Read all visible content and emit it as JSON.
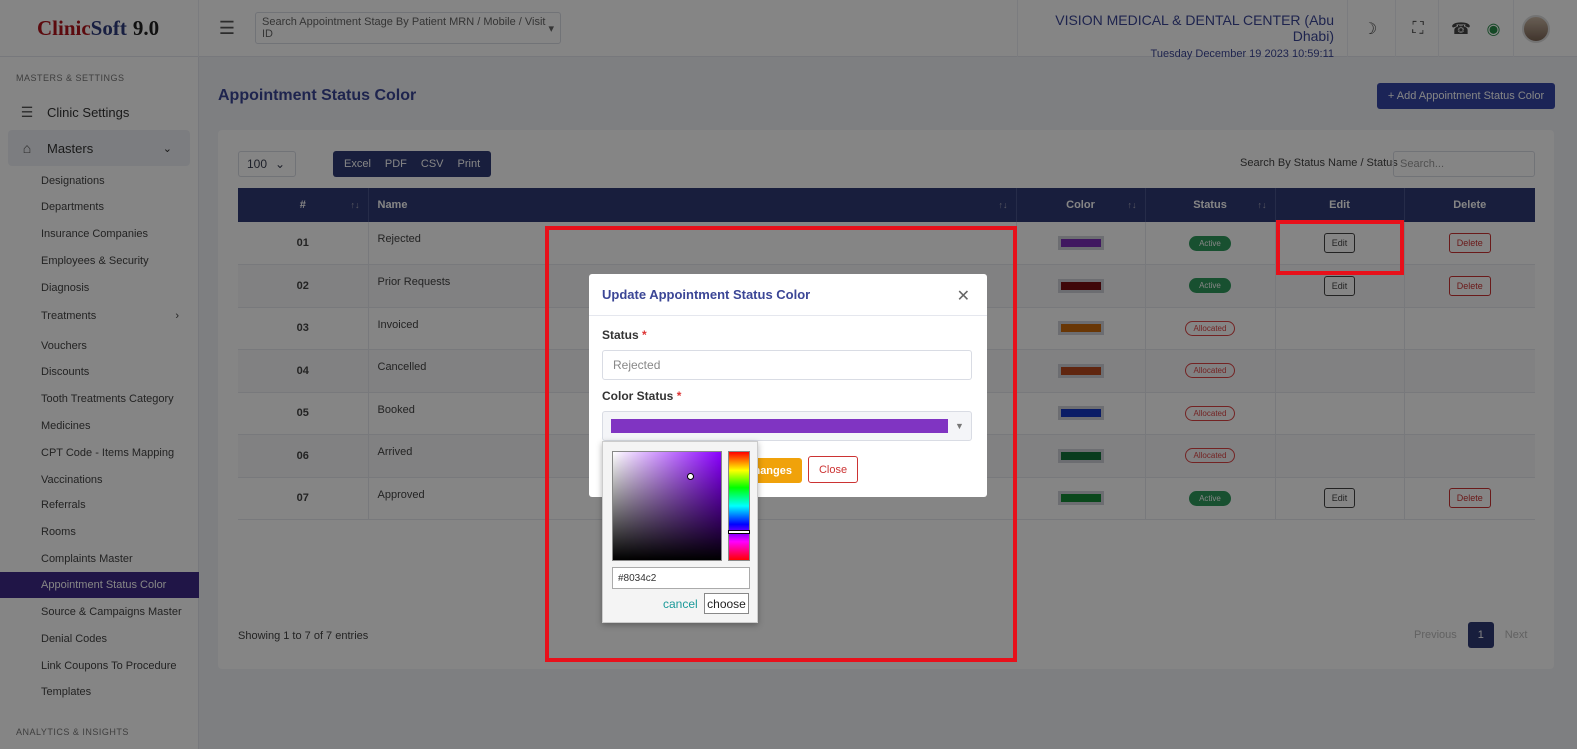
{
  "brand": {
    "part1": "Clinic",
    "part2": "Soft",
    "version": "9.0"
  },
  "header": {
    "search_placeholder": "Search Appointment Stage By Patient MRN / Mobile / Visit ID",
    "clinic_name": "VISION MEDICAL & DENTAL CENTER (Abu Dhabi)",
    "datetime": "Tuesday December 19 2023 10:59:11"
  },
  "sidebar": {
    "section1": "MASTERS & SETTINGS",
    "clinic_settings": "Clinic Settings",
    "masters": "Masters",
    "items": [
      "Designations",
      "Departments",
      "Insurance Companies",
      "Employees & Security",
      "Diagnosis",
      "Treatments",
      "Vouchers",
      "Discounts",
      "Tooth Treatments Category",
      "Medicines",
      "CPT Code - Items Mapping",
      "Vaccinations",
      "Referrals",
      "Rooms",
      "Complaints Master",
      "Appointment Status Color",
      "Source & Campaigns Master",
      "Denial Codes",
      "Link Coupons To Procedure",
      "Templates"
    ],
    "section2": "ANALYTICS & INSIGHTS"
  },
  "page": {
    "title": "Appointment Status Color",
    "add_button": "+ Add Appointment Status Color",
    "page_length": "100",
    "export": {
      "excel": "Excel",
      "pdf": "PDF",
      "csv": "CSV",
      "print": "Print"
    },
    "search_label": "Search By Status Name / Status",
    "search_placeholder": "Search...",
    "showing": "Showing 1 to 7 of 7 entries",
    "pager": {
      "previous": "Previous",
      "current": "1",
      "next": "Next"
    }
  },
  "table": {
    "headers": {
      "num": "#",
      "name": "Name",
      "color": "Color",
      "status": "Status",
      "edit": "Edit",
      "delete": "Delete"
    },
    "edit_label": "Edit",
    "delete_label": "Delete",
    "rows": [
      {
        "num": "01",
        "name": "Rejected",
        "color": "#7b2fb8",
        "status": "Active",
        "editable": true
      },
      {
        "num": "02",
        "name": "Prior Requests",
        "color": "#7a0f12",
        "status": "Active",
        "editable": true
      },
      {
        "num": "03",
        "name": "Invoiced",
        "color": "#c96a0d",
        "status": "Allocated",
        "editable": false
      },
      {
        "num": "04",
        "name": "Cancelled",
        "color": "#b84a1f",
        "status": "Allocated",
        "editable": false
      },
      {
        "num": "05",
        "name": "Booked",
        "color": "#1436c4",
        "status": "Allocated",
        "editable": false
      },
      {
        "num": "06",
        "name": "Arrived",
        "color": "#12743a",
        "status": "Allocated",
        "editable": false
      },
      {
        "num": "07",
        "name": "Approved",
        "color": "#158a36",
        "status": "Active",
        "editable": true
      }
    ]
  },
  "modal": {
    "title": "Update Appointment Status Color",
    "status_label": "Status",
    "status_value": "Rejected",
    "color_label": "Color Status",
    "color_value": "#8034c2",
    "save_label": "Changes",
    "close_label": "Close",
    "required_mark": "*"
  },
  "picker": {
    "hex": "#8034c2",
    "cancel": "cancel",
    "choose": "choose"
  }
}
